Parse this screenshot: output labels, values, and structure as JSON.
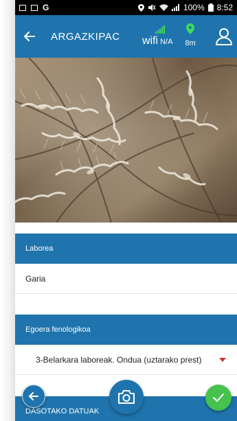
{
  "status_bar": {
    "battery_percent": "100%",
    "time": "8:52",
    "left_letter": "G"
  },
  "header": {
    "title": "ARGAZKIPAC",
    "wifi_word": "wifi",
    "wifi_value": "N/A",
    "gps_value": "8m"
  },
  "form": {
    "section1_label": "Laborea",
    "section1_value": "Garia",
    "section2_label": "Egoera fenologikoa",
    "section2_value": "3-Belarkara laboreak. Ondua (uztarako prest)",
    "section3_label": "DASOTAKO DATUAK"
  },
  "colors": {
    "primary": "#1f74ad",
    "accent_green": "#46c24f",
    "signal_green": "#3ddc5a",
    "caret_red": "#d0312d"
  },
  "icons": {
    "back": "arrow-left-icon",
    "user": "user-icon",
    "gps": "location-pin-icon",
    "signal": "signal-bars-icon",
    "camera": "camera-icon",
    "confirm": "check-icon"
  }
}
